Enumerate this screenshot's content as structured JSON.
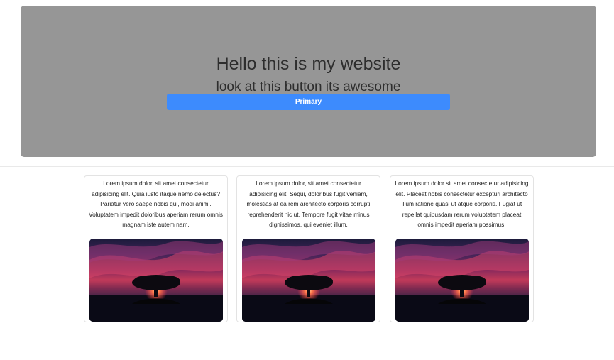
{
  "hero": {
    "title": "Hello this is my website",
    "subtitle": "look at this button its awesome",
    "button_label": "Primary",
    "background_color": "#969696",
    "button_color": "#3d8bfd"
  },
  "cards": [
    {
      "text": "Lorem ipsum dolor, sit amet consectetur adipisicing elit. Quia iusto itaque nemo delectus? Pariatur vero saepe nobis qui, modi animi. Voluptatem impedit doloribus aperiam rerum omnis magnam iste autem nam."
    },
    {
      "text": "Lorem ipsum dolor, sit amet consectetur adipisicing elit. Sequi, doloribus fugit veniam, molestias at ea rem architecto corporis corrupti reprehenderit hic ut. Tempore fugit vitae minus dignissimos, qui eveniet illum."
    },
    {
      "text": "Lorem ipsum dolor sit amet consectetur adipisicing elit. Placeat nobis consectetur excepturi architecto illum ratione quasi ut atque corporis. Fugiat ut repellat quibusdam rerum voluptatem placeat omnis impedit aperiam possimus."
    }
  ]
}
